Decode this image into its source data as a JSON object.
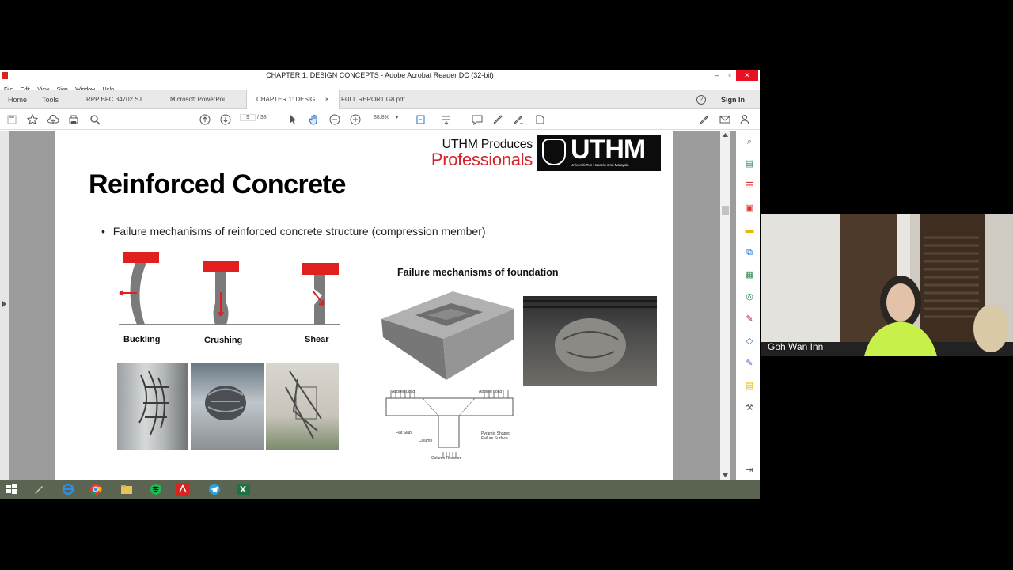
{
  "window": {
    "title": "CHAPTER 1:  DESIGN CONCEPTS - Adobe Acrobat Reader DC (32-bit)",
    "controls": {
      "minimize": "–",
      "maximize": "▫",
      "close": "✕"
    }
  },
  "menu": [
    "File",
    "Edit",
    "View",
    "Sign",
    "Window",
    "Help"
  ],
  "tabs": {
    "home": "Home",
    "tools": "Tools",
    "docs": [
      {
        "label": "RPP BFC 34702 ST...",
        "active": false
      },
      {
        "label": "Microsoft PowerPoi...",
        "active": false
      },
      {
        "label": "CHAPTER 1:  DESIG...",
        "active": true
      },
      {
        "label": "FULL REPORT G8.pdf",
        "active": false
      }
    ],
    "close_glyph": "×",
    "help_glyph": "?",
    "sign_in": "Sign In"
  },
  "toolbar": {
    "current_page": "9",
    "page_separator": "/ 38",
    "zoom": "88.8%",
    "zoom_caret": "▾"
  },
  "slide": {
    "brand_line1": "UTHM Produces",
    "brand_line2": "Professionals",
    "logo_text": "UTHM",
    "logo_subtext": "Universiti Tun Hussein Onn Malaysia",
    "title": "Reinforced Concrete",
    "bullet_marker": "•",
    "bullet": "Failure mechanisms of reinforced concrete structure (compression member)",
    "labels": {
      "buckling": "Buckling",
      "crushing": "Crushing",
      "shear": "Shear"
    },
    "foundation_heading": "Failure mechanisms of foundation",
    "diagram_labels": {
      "applied_load_left": "Applied Load",
      "applied_load_right": "Applied Load",
      "flat_slab": "Flat Slab",
      "column": "Column",
      "failure_surface": "Pyramid Shaped\nFailure Surface",
      "column_reaction": "Column Reaction"
    }
  },
  "webcam": {
    "participant_name": "Goh Wan Inn"
  },
  "colors": {
    "accent_red": "#e0201f",
    "title_black": "#000000",
    "taskbar": "#5a6450"
  }
}
